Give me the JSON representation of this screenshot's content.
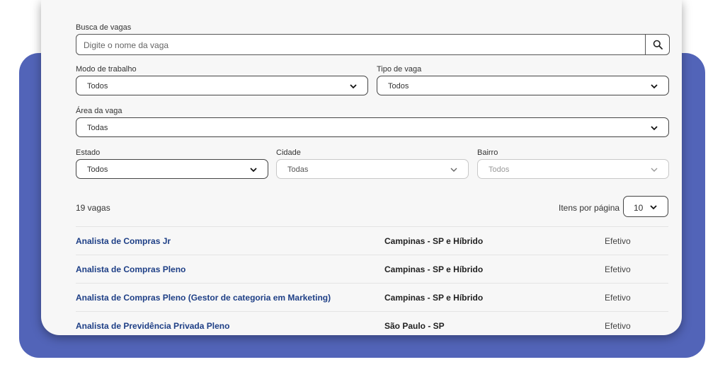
{
  "search": {
    "label": "Busca de vagas",
    "placeholder": "Digite o nome da vaga",
    "button_icon": "search-icon"
  },
  "filters": {
    "work_mode": {
      "label": "Modo de trabalho",
      "value": "Todos"
    },
    "job_type": {
      "label": "Tipo de vaga",
      "value": "Todos"
    },
    "area": {
      "label": "Área da vaga",
      "value": "Todas"
    },
    "state": {
      "label": "Estado",
      "value": "Todos"
    },
    "city": {
      "label": "Cidade",
      "value": "Todas"
    },
    "district": {
      "label": "Bairro",
      "value": "Todos"
    }
  },
  "results": {
    "count_text": "19 vagas",
    "per_page_label": "Itens por página",
    "per_page_value": "10"
  },
  "jobs": [
    {
      "title": "Analista de Compras Jr",
      "location": "Campinas - SP e Híbrido",
      "type": "Efetivo"
    },
    {
      "title": "Analista de Compras Pleno",
      "location": "Campinas - SP e Híbrido",
      "type": "Efetivo"
    },
    {
      "title": "Analista de Compras Pleno (Gestor de categoria em Marketing)",
      "location": "Campinas - SP e Híbrido",
      "type": "Efetivo"
    },
    {
      "title": "Analista de Previdência Privada Pleno",
      "location": "São Paulo - SP",
      "type": "Efetivo"
    }
  ],
  "colors": {
    "backdrop": "#5264b8",
    "card": "#f7f7f7",
    "job_title": "#1e3f86"
  }
}
